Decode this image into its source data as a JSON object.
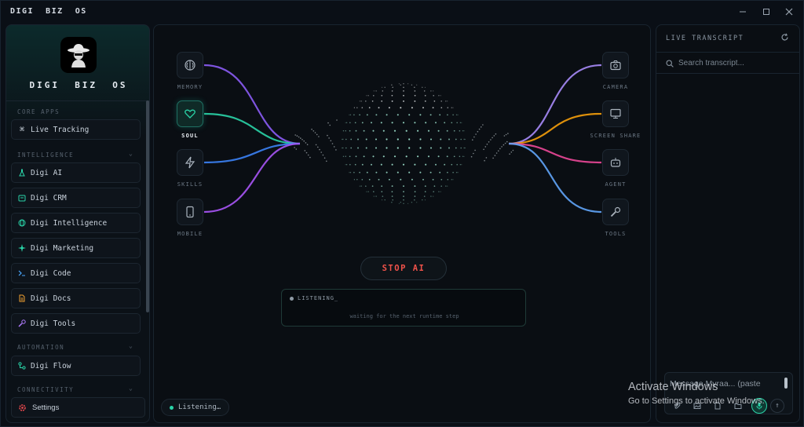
{
  "window": {
    "title": "DIGI  BIZ  OS",
    "controls": [
      "minimize",
      "maximize",
      "close"
    ]
  },
  "sidebar": {
    "brand": "DIGI  BIZ  OS",
    "logo_icon": "hacker-hat-icon",
    "sections": {
      "core": {
        "label": "CORE APPS"
      },
      "intelligence": {
        "label": "INTELLIGENCE"
      },
      "automation": {
        "label": "AUTOMATION"
      },
      "connectivity": {
        "label": "CONNECTIVITY"
      }
    },
    "items": [
      {
        "label": "Live Tracking",
        "icon": "command-icon",
        "color": "#c9d2dc"
      },
      {
        "label": "Digi AI",
        "icon": "flask-icon",
        "color": "#2ad4a8"
      },
      {
        "label": "Digi CRM",
        "icon": "crm-icon",
        "color": "#2ad4a8"
      },
      {
        "label": "Digi Intelligence",
        "icon": "globe-icon",
        "color": "#2ad4a8"
      },
      {
        "label": "Digi Marketing",
        "icon": "sparkle-icon",
        "color": "#2ad4a8"
      },
      {
        "label": "Digi Code",
        "icon": "terminal-icon",
        "color": "#4aa8ff"
      },
      {
        "label": "Digi Docs",
        "icon": "document-icon",
        "color": "#f0a030"
      },
      {
        "label": "Digi Tools",
        "icon": "wrench-icon",
        "color": "#b07cff"
      },
      {
        "label": "Digi Flow",
        "icon": "flow-icon",
        "color": "#2ad4a8"
      }
    ],
    "settings_label": "Settings"
  },
  "main": {
    "left_nodes": [
      {
        "label": "MEMORY",
        "icon": "brain-icon",
        "active": false
      },
      {
        "label": "SOUL",
        "icon": "heart-icon",
        "active": true
      },
      {
        "label": "SKILLS",
        "icon": "lightning-icon",
        "active": false
      },
      {
        "label": "MOBILE",
        "icon": "phone-icon",
        "active": false
      }
    ],
    "right_nodes": [
      {
        "label": "CAMERA",
        "icon": "camera-icon"
      },
      {
        "label": "SCREEN SHARE",
        "icon": "monitor-icon"
      },
      {
        "label": "AGENT",
        "icon": "bot-icon"
      },
      {
        "label": "TOOLS",
        "icon": "wrench-icon"
      }
    ],
    "link_colors": {
      "memory": "#8b5cf6",
      "soul": "#2ad4a8",
      "skills": "#3b82f6",
      "mobile": "#a855f7",
      "camera": "#a78bfa",
      "screen_share": "#f59e0b",
      "agent": "#ec4899",
      "tools": "#60a5fa"
    },
    "stop_label": "STOP AI",
    "console_status": "LISTENING_",
    "console_message": "waiting for the next runtime step",
    "listening_pill": "Listening…"
  },
  "transcript": {
    "title": "LIVE TRANSCRIPT",
    "search_placeholder": "Search transcript...",
    "message_placeholder": "Message Myraa... (paste",
    "tools": [
      "paperclip-icon",
      "image-icon",
      "file-icon",
      "folder-icon"
    ]
  },
  "overlay": {
    "activate_title": "Activate Windows",
    "activate_sub": "Go to Settings to activate Windows."
  }
}
